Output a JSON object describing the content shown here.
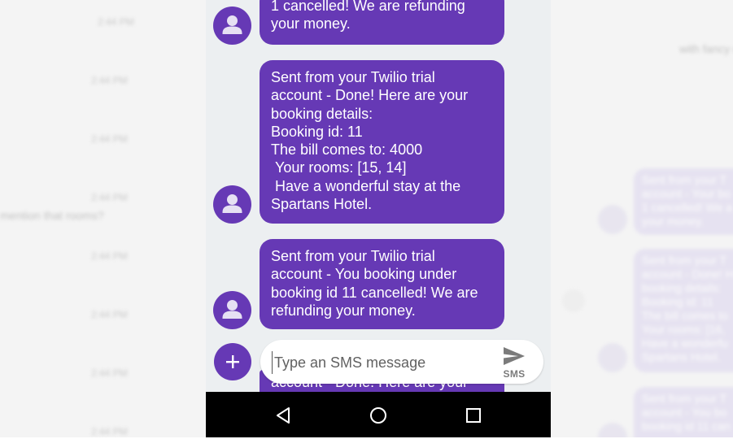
{
  "messages": [
    {
      "text": "1 cancelled! We are refunding\nyour money."
    },
    {
      "text": "Sent from your Twilio trial\naccount - Done! Here are your\nbooking details:\nBooking id: 11\nThe bill comes to: 4000\n Your rooms: [15, 14]\n Have a wonderful stay at the\nSpartans Hotel."
    },
    {
      "text": "Sent from your Twilio trial\naccount - You booking under\nbooking id 11 cancelled! We are\nrefunding your money."
    }
  ],
  "partial_message": "account - Done! Here are your",
  "compose": {
    "placeholder": "Type an SMS message",
    "send_label": "SMS"
  },
  "colors": {
    "accent": "#6639b5",
    "thread_background": "#eceff1",
    "navbar": "#000000"
  },
  "icons": {
    "avatar": "person-icon",
    "add": "plus-icon",
    "send": "send-icon",
    "back": "back-triangle-icon",
    "home": "home-circle-icon",
    "recents": "recents-square-icon"
  },
  "background_left": {
    "times": [
      "2:44 PM",
      "2:44 PM",
      "2:44 PM",
      "2:44 PM",
      "2:44 PM",
      "2:44 PM",
      "2:44 PM",
      "2:44 PM"
    ],
    "snippet": "mention that rooms?"
  },
  "background_right": {
    "header_snippet": "with fancy c",
    "bubbles": [
      "Sent from your T\naccount - Your bo\n1 cancelled! We a\nyour money.",
      "Sent from your T\naccount - Done! H\nbooking details:\nBooking id: 11\nThe bill comes to\n Your rooms: [16,\n Have a wonderfu\nSpartans Hotel.",
      "Sent from your T\naccount - You bo\nbooking id 11 can"
    ]
  }
}
